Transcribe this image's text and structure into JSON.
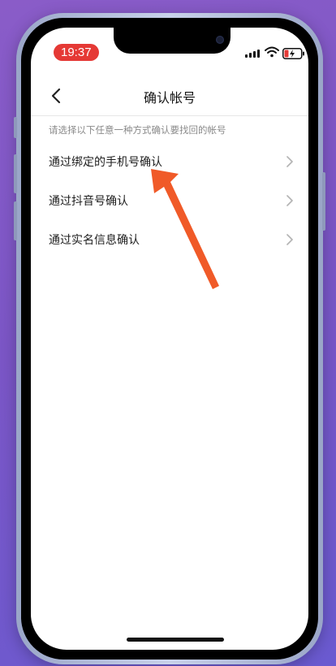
{
  "status_bar": {
    "time": "19:37"
  },
  "nav": {
    "title": "确认帐号",
    "back_icon": "chevron-left-icon"
  },
  "hint": "请选择以下任意一种方式确认要找回的帐号",
  "menu": [
    {
      "label": "通过绑定的手机号确认"
    },
    {
      "label": "通过抖音号确认"
    },
    {
      "label": "通过实名信息确认"
    }
  ],
  "colors": {
    "time_pill": "#e53935",
    "annotation_arrow": "#f05a28"
  }
}
